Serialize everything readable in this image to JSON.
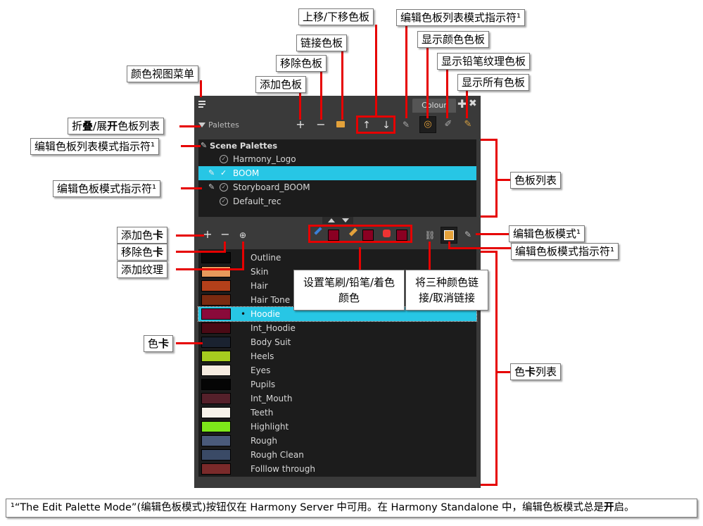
{
  "panel": {
    "tab_label": "Colour",
    "section_label": "Palettes",
    "scene_palettes_label": "Scene Palettes",
    "palettes": [
      {
        "name": "Harmony_Logo",
        "selected": false
      },
      {
        "name": "BOOM",
        "selected": true
      },
      {
        "name": "Storyboard_BOOM",
        "selected": false
      },
      {
        "name": "Default_rec",
        "selected": false
      }
    ],
    "swatches": [
      {
        "name": "Outline",
        "color": "#0a0a0a"
      },
      {
        "name": "Skin",
        "color": "#e69a5c"
      },
      {
        "name": "Hair",
        "color": "#b3401a"
      },
      {
        "name": "Hair Tone",
        "color": "#7a2a10"
      },
      {
        "name": "Hoodie",
        "color": "#8a0a3a"
      },
      {
        "name": "Int_Hoodie",
        "color": "#4a0a15"
      },
      {
        "name": "Body Suit",
        "color": "#1a2230"
      },
      {
        "name": "Heels",
        "color": "#a6cc1f"
      },
      {
        "name": "Eyes",
        "color": "#f5ebe0"
      },
      {
        "name": "Pupils",
        "color": "#050505"
      },
      {
        "name": "Int_Mouth",
        "color": "#55202a"
      },
      {
        "name": "Teeth",
        "color": "#f7f2ea"
      },
      {
        "name": "Highlight",
        "color": "#7de81a"
      },
      {
        "name": "Rough",
        "color": "#4a5a7a"
      },
      {
        "name": "Rough Clean",
        "color": "#3a4a66"
      },
      {
        "name": "Folllow through",
        "color": "#7a2a2a"
      }
    ],
    "selected_swatch": "Hoodie",
    "brush_colors": [
      "#8a0022",
      "#8a0022",
      "#8a0022"
    ]
  },
  "callouts": {
    "colour_view_menu": "颜色视图菜单",
    "add_palette": "添加色板",
    "remove_palette": "移除色板",
    "link_palette": "链接色板",
    "move_palette": "上移/下移色板",
    "edit_palette_list_mode_indicator_top": "编辑色板列表模式指示符¹",
    "show_colour_palettes": "显示颜色色板",
    "show_pencil_texture_palettes": "显示铅笔纹理色板",
    "show_all_palettes": "显示所有色板",
    "collapse_expand_a": "折",
    "collapse_expand_b": "叠",
    "collapse_expand_c": "/展",
    "collapse_expand_d": "开",
    "collapse_expand_e": "色板列表",
    "edit_palette_list_mode_indicator_left": "编辑色板列表模式指示符¹",
    "edit_palette_mode_indicator_left": "编辑色板模式指示符¹",
    "palette_list": "色板列表",
    "add_swatch_a": "添加色",
    "add_swatch_b": "卡",
    "remove_swatch_a": "移除色",
    "remove_swatch_b": "卡",
    "add_texture": "添加纹理",
    "edit_palette_mode": "编辑色板模式¹",
    "edit_palette_mode_indicator_right": "编辑色板模式指示符¹",
    "set_colours": "设置笔刷/铅笔/着色颜色",
    "link_three_colours": "将三种颜色链接/取消链接",
    "swatch_a": "色",
    "swatch_b": "卡",
    "swatch_list_a": "色",
    "swatch_list_b": "卡",
    "swatch_list_c": "列表"
  },
  "footnote": {
    "text_a": "¹“The Edit Palette Mode”(编辑色板模式)按钮仅在 Harmony Server 中可用。在 Harmony Standalone 中，编辑色板模式总是",
    "text_b": "开",
    "text_c": "启。"
  }
}
